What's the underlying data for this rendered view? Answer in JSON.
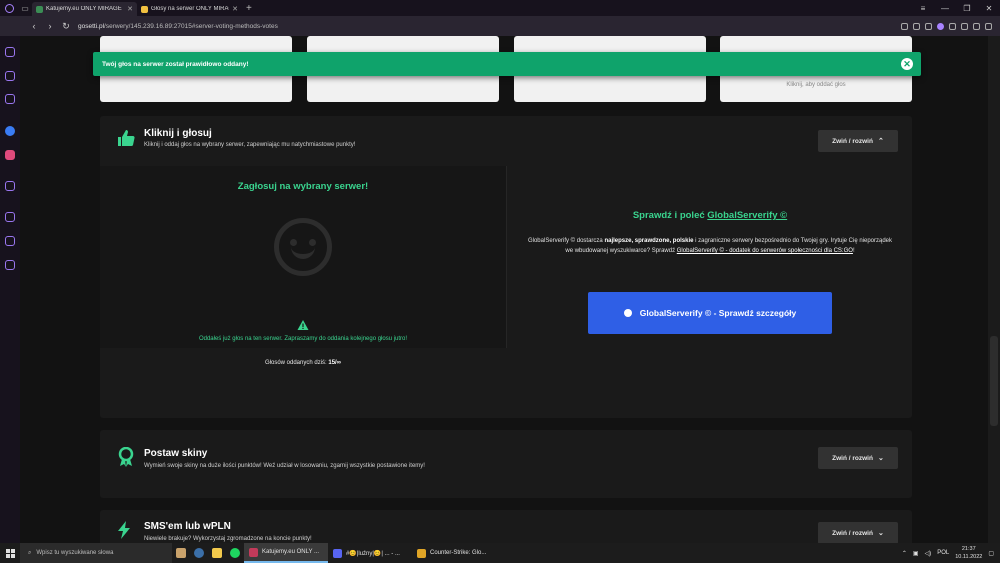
{
  "browser": {
    "tabs": [
      {
        "title": "Katujemy.eu ONLY MIRAGE",
        "active": true
      },
      {
        "title": "Głosy na serwer ONLY MIRAGE",
        "active": false
      }
    ],
    "url_domain": "gosetti.pl",
    "url_path": "/serwery/145.239.16.89:27015#server-voting-methods-votes"
  },
  "top_cards": {
    "card4_label": "Kliknij, aby oddać głos"
  },
  "toast": {
    "message": "Twój głos na serwer został prawidłowo oddany!",
    "close_glyph": "✕"
  },
  "click_vote": {
    "title": "Kliknij i głosuj",
    "subtitle": "Kliknij i oddaj głos na wybrany serwer, zapewniając mu natychmiastowe punkty!",
    "toggle_label": "Zwiń / rozwiń",
    "toggle_chevron": "⌃",
    "vote_title": "Zagłosuj na wybrany serwer!",
    "notice": "Oddałeś już głos na ten serwer. Zapraszamy do oddania kolejnego głosu jutro!",
    "count_label": "Głosów oddanych dziś:",
    "count_value": "15/∞"
  },
  "globalserverify": {
    "title_prefix": "Sprawdź i poleć",
    "title_link": "GlobalServerify ©",
    "desc_1": "GlobalServerify © dostarcza",
    "desc_bold": "najlepsze, sprawdzone, polskie",
    "desc_2": "i zagraniczne serwery bezpośrednio do Twojej gry. Irytuje Cię nieporządek we wbudowanej wyszukiwarce? Sprawdź",
    "desc_link": "GlobalServerify © - dodatek do serwerów społeczności dla CS:GO",
    "desc_end": "!",
    "button_label": "GlobalServerify © - Sprawdź szczegóły"
  },
  "skins": {
    "title": "Postaw skiny",
    "subtitle": "Wymień swoje skiny na duże ilości punktów! Weź udział w losowaniu, zgarnij wszystkie postawione itemy!",
    "toggle_label": "Zwiń / rozwiń",
    "toggle_chevron": "⌄"
  },
  "sms": {
    "title": "SMS'em lub wPLN",
    "subtitle": "Niewiele brakuje? Wykorzystaj zgromadzone na koncie punkty!",
    "toggle_label": "Zwiń / rozwiń",
    "toggle_chevron": "⌄"
  },
  "taskbar": {
    "search_placeholder": "Wpisz tu wyszukiwane słowa",
    "apps": [
      {
        "label": "Katujemy.eu ONLY ...",
        "color": "#c23a5a"
      },
      {
        "label": "#😊|luźny|😊| ... - ...",
        "color": "#5865f2"
      },
      {
        "label": "Counter-Strike: Glo...",
        "color": "#e0a526"
      }
    ],
    "lang": "POL",
    "time": "21:37",
    "date": "10.11.2022"
  },
  "colors": {
    "accent_green": "#3ad48f",
    "toast_green": "#0fa36b",
    "button_blue": "#2f5fe6"
  }
}
